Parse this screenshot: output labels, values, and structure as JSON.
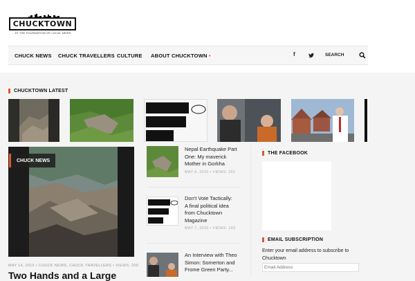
{
  "site": {
    "logo_text": "CHUCKTOWN",
    "logo_tagline": "AT THE FOUNDATION OF LOCAL NEWS"
  },
  "nav": {
    "items": [
      "CHUCK NEWS",
      "CHUCK TRAVELLERS",
      "CULTURE",
      "ABOUT CHUCKTOWN"
    ],
    "about_indicator": "•",
    "social": [
      "facebook-icon",
      "twitter-icon"
    ],
    "social_glyphs": [
      "f",
      "🐦"
    ],
    "search_label": "SEARCH"
  },
  "latest": {
    "heading": "CHUCKTOWN LATEST"
  },
  "featured": {
    "category_badge": "CHUCK NEWS",
    "meta": "MAY 14, 2015 • CHUCK NEWS, CHUCK TRAVELLERS • VIEWS: 209",
    "title": "Two Hands and a Large"
  },
  "posts": [
    {
      "title_lines": [
        "Nepal Earthquake Part",
        "One: My maverick",
        "Mother in Gorkha"
      ],
      "meta": "MAY 8, 2015 • VIEWS: 251"
    },
    {
      "title_lines": [
        "Don't Vote Tactically:",
        "A final political idea",
        "from Chucktown",
        "Magazine"
      ],
      "meta": "MAY 7, 2015 • VIEWS: 183"
    },
    {
      "title_lines": [
        "An Interview with Theo",
        "Simon: Somerton and",
        "Frome Green Party..."
      ],
      "meta": ""
    }
  ],
  "sidebar": {
    "facebook_heading": "THE FACEBOOK",
    "email_heading": "EMAIL SUBSCRIPTION",
    "email_text": "Enter your email address to subscribe to Chucktown",
    "email_placeholder": "Email Address"
  },
  "colors": {
    "accent": "#e2572b",
    "nav_bg": "#f6f6f6",
    "page_bg": "#f4f4f4"
  }
}
